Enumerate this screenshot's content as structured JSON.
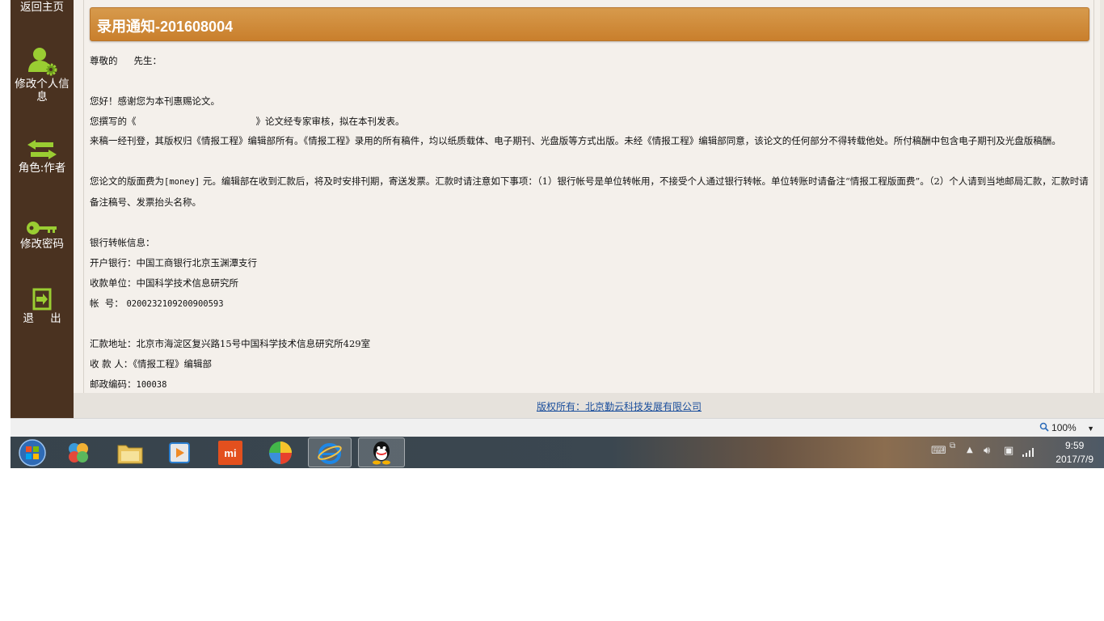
{
  "sidebar": {
    "items": [
      {
        "label": "返回主页",
        "icon": "home-icon"
      },
      {
        "label": "修改个人信息",
        "icon": "user-settings-icon"
      },
      {
        "label": "角色:作者",
        "icon": "swap-arrows-icon"
      },
      {
        "label": "修改密码",
        "icon": "key-icon"
      },
      {
        "label": "退 出",
        "icon": "exit-icon"
      }
    ]
  },
  "notice": {
    "title": "录用通知-201608004",
    "salutation": "尊敬的",
    "salutation_suffix": "先生：",
    "greeting": "您好！感谢您为本刊惠赐论文。",
    "paper_prefix": "您撰写的《",
    "paper_suffix": "》论文经专家审核，拟在本刊发表。",
    "copyright_para": "来稿一经刊登，其版权归《情报工程》编辑部所有。《情报工程》录用的所有稿件，均以纸质载体、电子期刊、光盘版等方式出版。未经《情报工程》编辑部同意，该论文的任何部分不得转载他处。所付稿酬中包含电子期刊及光盘版稿酬。",
    "fee_prefix": "您论文的版面费为",
    "fee_value": "[money]",
    "fee_rest": "元。编辑部在收到汇款后，将及时安排刊期，寄送发票。汇款时请注意如下事项：（1）银行帐号是单位转帐用，不接受个人通过银行转帐。单位转账时请备注“情报工程版面费”。（2）个人请到当地邮局汇款，汇款时请备注稿号、发票抬头名称。",
    "bank_header": "银行转帐信息：",
    "bank_name_label": "开户银行：",
    "bank_name": "中国工商银行北京玉渊潭支行",
    "payee_unit_label": "收款单位：",
    "payee_unit": "中国科学技术信息研究所",
    "account_label": "帐  号：",
    "account": "0200232109200900593",
    "address_label": "汇款地址：",
    "address": "北京市海淀区复兴路15号中国科学技术信息研究所429室",
    "recipient_label": "收 款 人：",
    "recipient": "《情报工程》编辑部",
    "postcode_label": "邮政编码：",
    "postcode": "100038"
  },
  "footer": {
    "copyright": "版权所有：北京勤云科技发展有限公司"
  },
  "statusbar": {
    "zoom": "100%"
  },
  "taskbar": {
    "apps": [
      "start-orb-icon",
      "pinwheel-app-icon",
      "file-explorer-icon",
      "media-player-icon",
      "mi-app-icon",
      "color-ball-app-icon",
      "ie-browser-icon",
      "qq-icon"
    ],
    "time": "9:59",
    "date": "2017/7/9"
  },
  "colors": {
    "sidebar_bg": "#4a3220",
    "title_bar": "#d08a3a",
    "accent_green": "#9acd32",
    "link_blue": "#1a4e9c"
  }
}
